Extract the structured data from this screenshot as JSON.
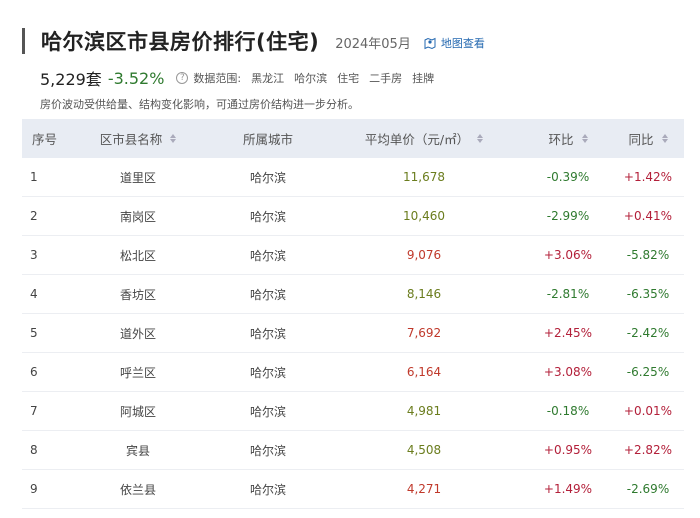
{
  "header": {
    "title": "哈尔滨区市县房价排行(住宅)",
    "date": "2024年05月",
    "map_link": "地图查看"
  },
  "stats": {
    "count": "5,229套",
    "change": "-3.52%",
    "range_label": "数据范围:",
    "range_items": [
      "黑龙江",
      "哈尔滨",
      "住宅",
      "二手房",
      "挂牌"
    ]
  },
  "note": "房价波动受供给量、结构变化影响，可通过房价结构进一步分析。",
  "table": {
    "columns": [
      "序号",
      "区市县名称",
      "所属城市",
      "平均单价（元/㎡）",
      "环比",
      "同比"
    ],
    "rows": [
      {
        "idx": "1",
        "name": "道里区",
        "city": "哈尔滨",
        "price": "11,678",
        "price_color": "#6b7d1e",
        "mom": "-0.39%",
        "yoy": "+1.42%"
      },
      {
        "idx": "2",
        "name": "南岗区",
        "city": "哈尔滨",
        "price": "10,460",
        "price_color": "#6b7d1e",
        "mom": "-2.99%",
        "yoy": "+0.41%"
      },
      {
        "idx": "3",
        "name": "松北区",
        "city": "哈尔滨",
        "price": "9,076",
        "price_color": "#c0392b",
        "mom": "+3.06%",
        "yoy": "-5.82%"
      },
      {
        "idx": "4",
        "name": "香坊区",
        "city": "哈尔滨",
        "price": "8,146",
        "price_color": "#6b7d1e",
        "mom": "-2.81%",
        "yoy": "-6.35%"
      },
      {
        "idx": "5",
        "name": "道外区",
        "city": "哈尔滨",
        "price": "7,692",
        "price_color": "#c0392b",
        "mom": "+2.45%",
        "yoy": "-2.42%"
      },
      {
        "idx": "6",
        "name": "呼兰区",
        "city": "哈尔滨",
        "price": "6,164",
        "price_color": "#c0392b",
        "mom": "+3.08%",
        "yoy": "-6.25%"
      },
      {
        "idx": "7",
        "name": "阿城区",
        "city": "哈尔滨",
        "price": "4,981",
        "price_color": "#6b7d1e",
        "mom": "-0.18%",
        "yoy": "+0.01%"
      },
      {
        "idx": "8",
        "name": "宾县",
        "city": "哈尔滨",
        "price": "4,508",
        "price_color": "#6b7d1e",
        "mom": "+0.95%",
        "yoy": "+2.82%"
      },
      {
        "idx": "9",
        "name": "依兰县",
        "city": "哈尔滨",
        "price": "4,271",
        "price_color": "#c0392b",
        "mom": "+1.49%",
        "yoy": "-2.69%"
      }
    ]
  },
  "colors": {
    "negative": "#2f7a2f",
    "positive": "#b3203a",
    "header_bg": "#e8ecf3",
    "link": "#2468b0"
  }
}
